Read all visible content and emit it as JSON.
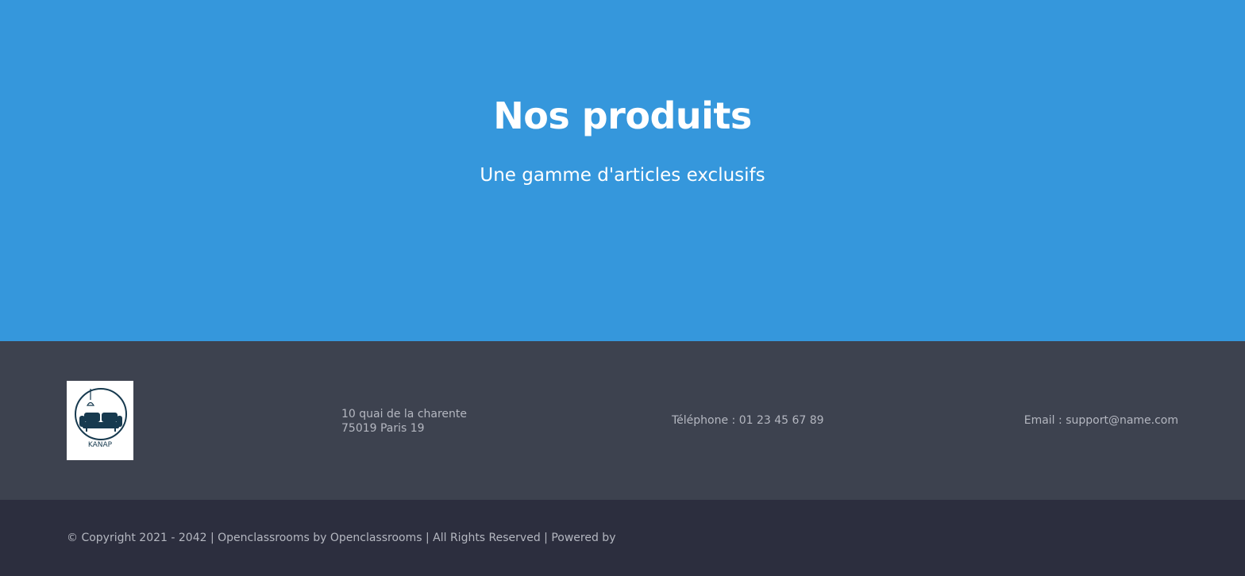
{
  "hero": {
    "title": "Nos produits",
    "subtitle": "Une gamme d'articles exclusifs"
  },
  "footer": {
    "logo": {
      "icon": "sofa-logo-icon",
      "text": "KANAP"
    },
    "address": {
      "line1": "10 quai de la charente",
      "line2": "75019 Paris 19"
    },
    "phone": "Téléphone : 01 23 45 67 89",
    "email": "Email : support@name.com",
    "copyright": "© Copyright 2021 - 2042 | Openclassrooms by Openclassrooms | All Rights Reserved | Powered by"
  },
  "colors": {
    "hero_background": "#3597dc",
    "footer_background": "#3d424f",
    "footer_bottom_background": "#2c2e3e",
    "footer_text": "#b4b7c0",
    "logo_color": "#173a4f"
  }
}
